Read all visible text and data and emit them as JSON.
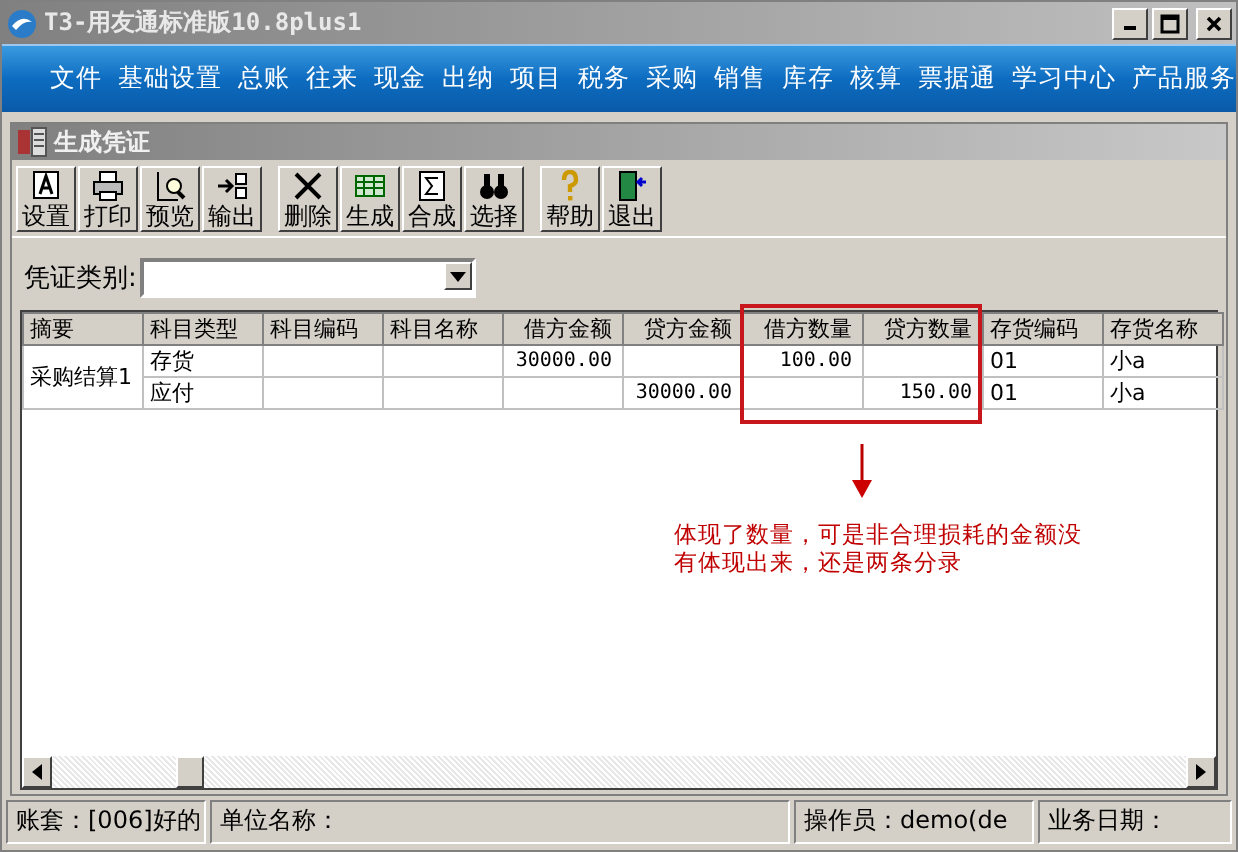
{
  "window": {
    "title": "T3-用友通标准版10.8plus1"
  },
  "menu": [
    "文件",
    "基础设置",
    "总账",
    "往来",
    "现金",
    "出纳",
    "项目",
    "税务",
    "采购",
    "销售",
    "库存",
    "核算",
    "票据通",
    "学习中心",
    "产品服务"
  ],
  "voucher_window": {
    "title": "生成凭证"
  },
  "toolbar": [
    [
      "设置",
      "打印",
      "预览",
      "输出"
    ],
    [
      "删除",
      "生成",
      "合成",
      "选择"
    ],
    [
      "帮助",
      "退出"
    ]
  ],
  "voucher_type": {
    "label": "凭证类别:"
  },
  "table": {
    "columns": [
      "摘要",
      "科目类型",
      "科目编码",
      "科目名称",
      "借方金额",
      "贷方金额",
      "借方数量",
      "贷方数量",
      "存货编码",
      "存货名称"
    ],
    "groups": [
      {
        "summary": "采购结算1",
        "rows": [
          {
            "subject_type": "存货",
            "debit_amount": "30000.00",
            "debit_qty": "100.00",
            "inventory_code": "01",
            "inventory_name": "小a"
          },
          {
            "subject_type": "应付",
            "credit_amount": "30000.00",
            "credit_qty": "150.00",
            "inventory_code": "01",
            "inventory_name": "小a"
          }
        ]
      }
    ]
  },
  "annotation": {
    "lines": [
      "体现了数量，可是非合理损耗的金额没",
      "有体现出来，还是两条分录"
    ]
  },
  "status_bar": [
    "账套：[006]好的",
    "单位名称：",
    "操作员：demo(de",
    "业务日期："
  ]
}
